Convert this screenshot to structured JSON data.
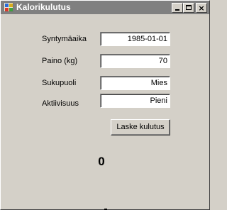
{
  "window": {
    "title": "Kalorikulutus",
    "controls": {
      "minimize": "minimize",
      "maximize": "maximize",
      "close": "×"
    }
  },
  "form": {
    "fields": [
      {
        "label": "Syntymäaika",
        "value": "1985-01-01"
      },
      {
        "label": "Paino (kg)",
        "value": "70"
      },
      {
        "label": "Sukupuoli",
        "value": "Mies"
      },
      {
        "label": "Aktiivisuus",
        "value": "Pieni"
      }
    ],
    "calculate_button": "Laske kulutus",
    "result": "0"
  },
  "colors": {
    "window_bg": "#d4d0c8",
    "titlebar_inactive": "#808080",
    "field_bg": "#ffffff"
  }
}
